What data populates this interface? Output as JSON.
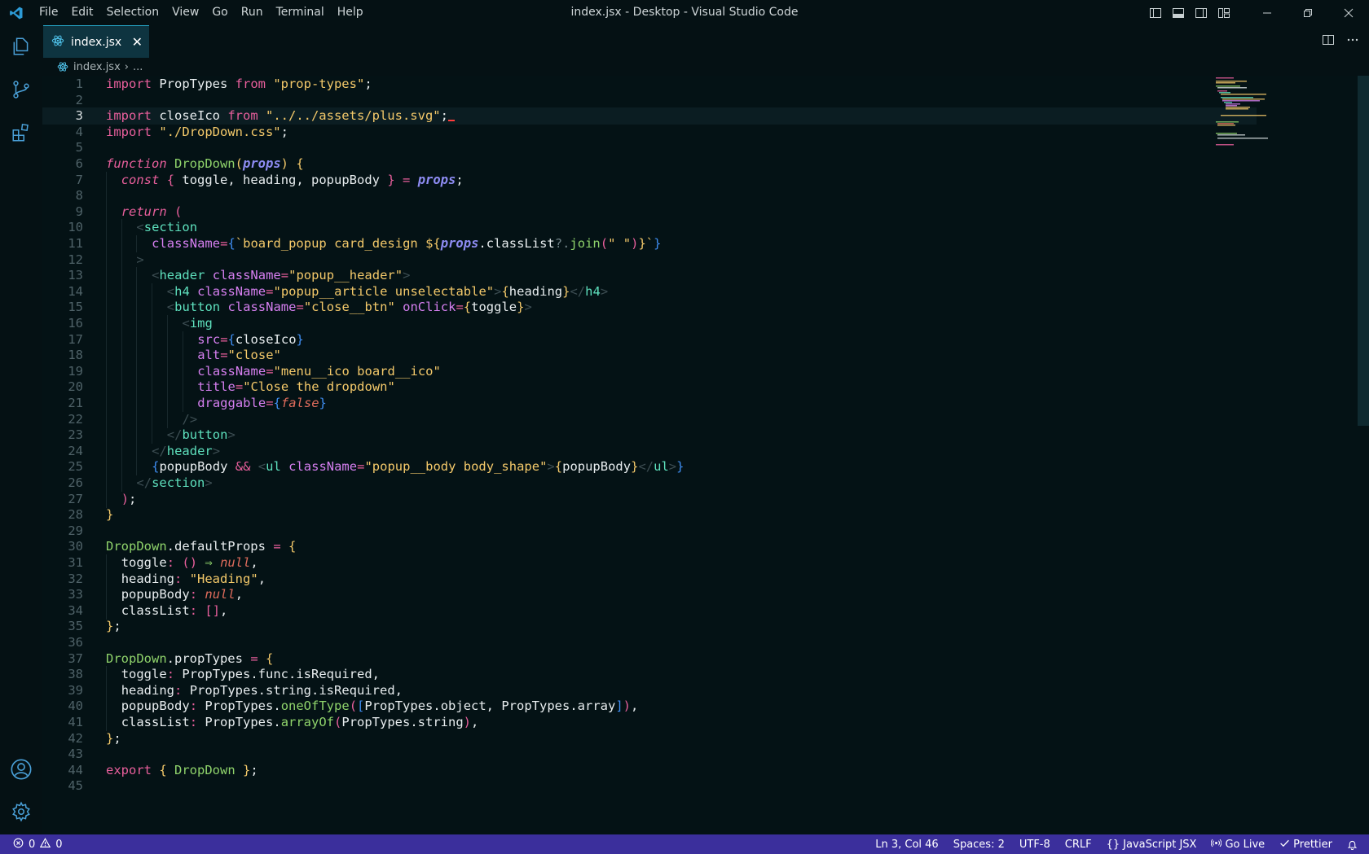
{
  "window": {
    "title": "index.jsx - Desktop - Visual Studio Code"
  },
  "menu": [
    "File",
    "Edit",
    "Selection",
    "View",
    "Go",
    "Run",
    "Terminal",
    "Help"
  ],
  "tab": {
    "label": "index.jsx",
    "close": "✕"
  },
  "breadcrumb": {
    "file": "index.jsx",
    "sep": "›",
    "more": "..."
  },
  "editor": {
    "current_line": 3,
    "lines": [
      {
        "n": 1,
        "i": 0,
        "t": [
          [
            "kw",
            "import"
          ],
          [
            "id",
            " PropTypes "
          ],
          [
            "kw",
            "from"
          ],
          [
            "str",
            " \"prop-types\""
          ],
          [
            "id",
            ";"
          ]
        ]
      },
      {
        "n": 2,
        "i": 0,
        "t": []
      },
      {
        "n": 3,
        "i": 0,
        "t": [
          [
            "kw",
            "import"
          ],
          [
            "id",
            " closeIco "
          ],
          [
            "kw",
            "from"
          ],
          [
            "str",
            " \"../../assets/plus.svg\""
          ],
          [
            "id",
            ";"
          ]
        ]
      },
      {
        "n": 4,
        "i": 0,
        "t": [
          [
            "kw",
            "import"
          ],
          [
            "str",
            " \"./DropDown.css\""
          ],
          [
            "id",
            ";"
          ]
        ]
      },
      {
        "n": 5,
        "i": 0,
        "t": []
      },
      {
        "n": 6,
        "i": 0,
        "t": [
          [
            "kwi",
            "function"
          ],
          [
            "fn",
            " DropDown"
          ],
          [
            "br",
            "("
          ],
          [
            "prm",
            "props"
          ],
          [
            "br",
            ")"
          ],
          [
            "id",
            " "
          ],
          [
            "br",
            "{"
          ]
        ]
      },
      {
        "n": 7,
        "i": 1,
        "t": [
          [
            "kwi",
            "const"
          ],
          [
            "id",
            " "
          ],
          [
            "br2",
            "{"
          ],
          [
            "id",
            " toggle, heading, popupBody "
          ],
          [
            "br2",
            "}"
          ],
          [
            "op",
            " = "
          ],
          [
            "prm",
            "props"
          ],
          [
            "id",
            ";"
          ]
        ]
      },
      {
        "n": 8,
        "i": 1,
        "t": []
      },
      {
        "n": 9,
        "i": 1,
        "t": [
          [
            "kwi",
            "return"
          ],
          [
            "id",
            " "
          ],
          [
            "br2",
            "("
          ]
        ]
      },
      {
        "n": 10,
        "i": 2,
        "t": [
          [
            "ang",
            "<"
          ],
          [
            "tag",
            "section"
          ]
        ]
      },
      {
        "n": 11,
        "i": 3,
        "t": [
          [
            "attr",
            "className"
          ],
          [
            "op",
            "="
          ],
          [
            "br3",
            "{"
          ],
          [
            "str",
            "`board_popup card_design "
          ],
          [
            "br",
            "${"
          ],
          [
            "prm",
            "props"
          ],
          [
            "id",
            ".classList"
          ],
          [
            "dim",
            "?."
          ],
          [
            "fn",
            "join"
          ],
          [
            "br2",
            "("
          ],
          [
            "str",
            "\" \""
          ],
          [
            "br2",
            ")"
          ],
          [
            "br",
            "}"
          ],
          [
            "str",
            "`"
          ],
          [
            "br3",
            "}"
          ]
        ]
      },
      {
        "n": 12,
        "i": 2,
        "t": [
          [
            "ang",
            ">"
          ]
        ]
      },
      {
        "n": 13,
        "i": 3,
        "t": [
          [
            "ang",
            "<"
          ],
          [
            "tag",
            "header"
          ],
          [
            "attr",
            " className"
          ],
          [
            "op",
            "="
          ],
          [
            "str",
            "\"popup__header\""
          ],
          [
            "ang",
            ">"
          ]
        ]
      },
      {
        "n": 14,
        "i": 4,
        "t": [
          [
            "ang",
            "<"
          ],
          [
            "tag",
            "h4"
          ],
          [
            "attr",
            " className"
          ],
          [
            "op",
            "="
          ],
          [
            "str",
            "\"popup__article unselectable\""
          ],
          [
            "ang",
            ">"
          ],
          [
            "br",
            "{"
          ],
          [
            "id",
            "heading"
          ],
          [
            "br",
            "}"
          ],
          [
            "ang",
            "</"
          ],
          [
            "tag",
            "h4"
          ],
          [
            "ang",
            ">"
          ]
        ]
      },
      {
        "n": 15,
        "i": 4,
        "t": [
          [
            "ang",
            "<"
          ],
          [
            "tag",
            "button"
          ],
          [
            "attr",
            " className"
          ],
          [
            "op",
            "="
          ],
          [
            "str",
            "\"close__btn\""
          ],
          [
            "attr",
            " onClick"
          ],
          [
            "op",
            "="
          ],
          [
            "br",
            "{"
          ],
          [
            "id",
            "toggle"
          ],
          [
            "br",
            "}"
          ],
          [
            "ang",
            ">"
          ]
        ]
      },
      {
        "n": 16,
        "i": 5,
        "t": [
          [
            "ang",
            "<"
          ],
          [
            "tag",
            "img"
          ]
        ]
      },
      {
        "n": 17,
        "i": 6,
        "t": [
          [
            "attr",
            "src"
          ],
          [
            "op",
            "="
          ],
          [
            "br3",
            "{"
          ],
          [
            "id",
            "closeIco"
          ],
          [
            "br3",
            "}"
          ]
        ]
      },
      {
        "n": 18,
        "i": 6,
        "t": [
          [
            "attr",
            "alt"
          ],
          [
            "op",
            "="
          ],
          [
            "str",
            "\"close\""
          ]
        ]
      },
      {
        "n": 19,
        "i": 6,
        "t": [
          [
            "attr",
            "className"
          ],
          [
            "op",
            "="
          ],
          [
            "str",
            "\"menu__ico board__ico\""
          ]
        ]
      },
      {
        "n": 20,
        "i": 6,
        "t": [
          [
            "attr",
            "title"
          ],
          [
            "op",
            "="
          ],
          [
            "str",
            "\"Close the dropdown\""
          ]
        ]
      },
      {
        "n": 21,
        "i": 6,
        "t": [
          [
            "attr",
            "draggable"
          ],
          [
            "op",
            "="
          ],
          [
            "br3",
            "{"
          ],
          [
            "nul",
            "false"
          ],
          [
            "br3",
            "}"
          ]
        ]
      },
      {
        "n": 22,
        "i": 5,
        "t": [
          [
            "ang",
            "/>"
          ]
        ]
      },
      {
        "n": 23,
        "i": 4,
        "t": [
          [
            "ang",
            "</"
          ],
          [
            "tag",
            "button"
          ],
          [
            "ang",
            ">"
          ]
        ]
      },
      {
        "n": 24,
        "i": 3,
        "t": [
          [
            "ang",
            "</"
          ],
          [
            "tag",
            "header"
          ],
          [
            "ang",
            ">"
          ]
        ]
      },
      {
        "n": 25,
        "i": 3,
        "t": [
          [
            "br3",
            "{"
          ],
          [
            "id",
            "popupBody "
          ],
          [
            "op",
            "&&"
          ],
          [
            "ang",
            " <"
          ],
          [
            "tag",
            "ul"
          ],
          [
            "attr",
            " className"
          ],
          [
            "op",
            "="
          ],
          [
            "str",
            "\"popup__body body_shape\""
          ],
          [
            "ang",
            ">"
          ],
          [
            "br",
            "{"
          ],
          [
            "id",
            "popupBody"
          ],
          [
            "br",
            "}"
          ],
          [
            "ang",
            "</"
          ],
          [
            "tag",
            "ul"
          ],
          [
            "ang",
            ">"
          ],
          [
            "br3",
            "}"
          ]
        ]
      },
      {
        "n": 26,
        "i": 2,
        "t": [
          [
            "ang",
            "</"
          ],
          [
            "tag",
            "section"
          ],
          [
            "ang",
            ">"
          ]
        ]
      },
      {
        "n": 27,
        "i": 1,
        "t": [
          [
            "br2",
            ")"
          ],
          [
            "id",
            ";"
          ]
        ]
      },
      {
        "n": 28,
        "i": 0,
        "t": [
          [
            "br",
            "}"
          ]
        ]
      },
      {
        "n": 29,
        "i": 0,
        "t": []
      },
      {
        "n": 30,
        "i": 0,
        "t": [
          [
            "fn",
            "DropDown"
          ],
          [
            "id",
            ".defaultProps "
          ],
          [
            "op",
            "="
          ],
          [
            "id",
            " "
          ],
          [
            "br",
            "{"
          ]
        ]
      },
      {
        "n": 31,
        "i": 1,
        "t": [
          [
            "id",
            "toggle"
          ],
          [
            "op",
            ":"
          ],
          [
            "id",
            " "
          ],
          [
            "br2",
            "()"
          ],
          [
            "id",
            " "
          ],
          [
            "fn",
            "⇒"
          ],
          [
            "id",
            " "
          ],
          [
            "nul",
            "null"
          ],
          [
            "id",
            ","
          ]
        ]
      },
      {
        "n": 32,
        "i": 1,
        "t": [
          [
            "id",
            "heading"
          ],
          [
            "op",
            ":"
          ],
          [
            "str",
            " \"Heading\""
          ],
          [
            "id",
            ","
          ]
        ]
      },
      {
        "n": 33,
        "i": 1,
        "t": [
          [
            "id",
            "popupBody"
          ],
          [
            "op",
            ":"
          ],
          [
            "id",
            " "
          ],
          [
            "nul",
            "null"
          ],
          [
            "id",
            ","
          ]
        ]
      },
      {
        "n": 34,
        "i": 1,
        "t": [
          [
            "id",
            "classList"
          ],
          [
            "op",
            ":"
          ],
          [
            "id",
            " "
          ],
          [
            "br2",
            "[]"
          ],
          [
            "id",
            ","
          ]
        ]
      },
      {
        "n": 35,
        "i": 0,
        "t": [
          [
            "br",
            "}"
          ],
          [
            "id",
            ";"
          ]
        ]
      },
      {
        "n": 36,
        "i": 0,
        "t": []
      },
      {
        "n": 37,
        "i": 0,
        "t": [
          [
            "fn",
            "DropDown"
          ],
          [
            "id",
            ".propTypes "
          ],
          [
            "op",
            "="
          ],
          [
            "id",
            " "
          ],
          [
            "br",
            "{"
          ]
        ]
      },
      {
        "n": 38,
        "i": 1,
        "t": [
          [
            "id",
            "toggle"
          ],
          [
            "op",
            ":"
          ],
          [
            "id",
            " PropTypes.func.isRequired,"
          ]
        ]
      },
      {
        "n": 39,
        "i": 1,
        "t": [
          [
            "id",
            "heading"
          ],
          [
            "op",
            ":"
          ],
          [
            "id",
            " PropTypes.string.isRequired,"
          ]
        ]
      },
      {
        "n": 40,
        "i": 1,
        "t": [
          [
            "id",
            "popupBody"
          ],
          [
            "op",
            ":"
          ],
          [
            "id",
            " PropTypes."
          ],
          [
            "fn",
            "oneOfType"
          ],
          [
            "br2",
            "("
          ],
          [
            "br3",
            "["
          ],
          [
            "id",
            "PropTypes.object, PropTypes.array"
          ],
          [
            "br3",
            "]"
          ],
          [
            "br2",
            ")"
          ],
          [
            "id",
            ","
          ]
        ]
      },
      {
        "n": 41,
        "i": 1,
        "t": [
          [
            "id",
            "classList"
          ],
          [
            "op",
            ":"
          ],
          [
            "id",
            " PropTypes."
          ],
          [
            "fn",
            "arrayOf"
          ],
          [
            "br2",
            "("
          ],
          [
            "id",
            "PropTypes.string"
          ],
          [
            "br2",
            ")"
          ],
          [
            "id",
            ","
          ]
        ]
      },
      {
        "n": 42,
        "i": 0,
        "t": [
          [
            "br",
            "}"
          ],
          [
            "id",
            ";"
          ]
        ]
      },
      {
        "n": 43,
        "i": 0,
        "t": []
      },
      {
        "n": 44,
        "i": 0,
        "t": [
          [
            "kw",
            "export"
          ],
          [
            "id",
            " "
          ],
          [
            "br",
            "{"
          ],
          [
            "fn",
            " DropDown "
          ],
          [
            "br",
            "}"
          ],
          [
            "id",
            ";"
          ]
        ]
      },
      {
        "n": 45,
        "i": 0,
        "t": []
      }
    ]
  },
  "status": {
    "errors": "0",
    "warnings": "0",
    "position": "Ln 3, Col 46",
    "spaces": "Spaces: 2",
    "encoding": "UTF-8",
    "eol": "CRLF",
    "language": "JavaScript JSX",
    "golive": "Go Live",
    "prettier": "Prettier"
  },
  "colors": {
    "statusbar": "#3b2f9c",
    "tab_active": "#0e3440",
    "background": "#051114",
    "accent": "#26a6c8"
  },
  "icons": [
    "vscode-logo-icon",
    "explorer-icon",
    "source-control-icon",
    "extensions-icon",
    "account-icon",
    "settings-gear-icon",
    "react-file-icon",
    "split-editor-icon",
    "more-actions-icon",
    "error-icon",
    "warning-icon",
    "bell-icon",
    "broadcast-icon",
    "check-icon",
    "braces-icon"
  ]
}
